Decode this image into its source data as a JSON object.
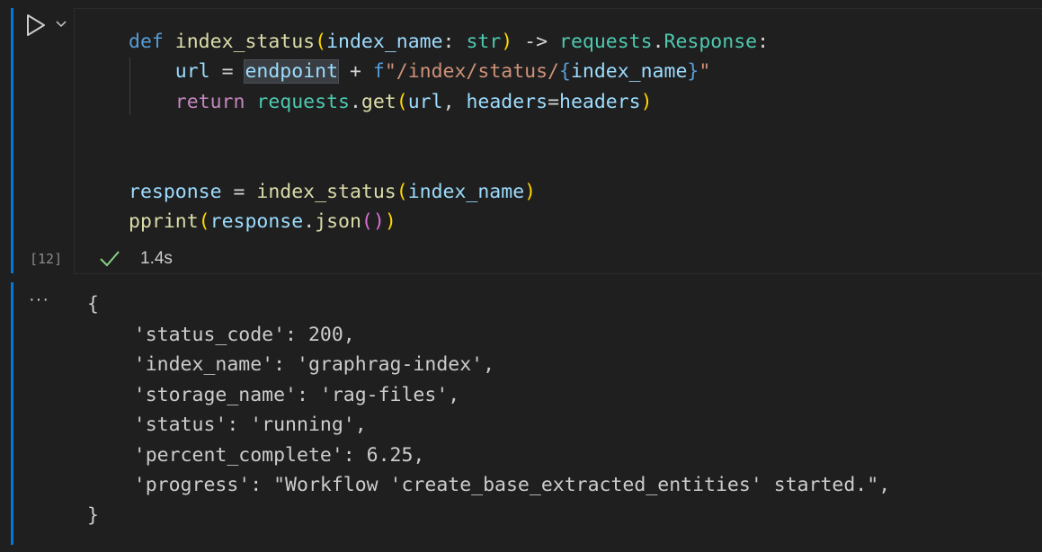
{
  "cell": {
    "execution_count": "[12]",
    "exec_time": "1.4s",
    "status": "success",
    "code": {
      "line1": {
        "kw": "def",
        "fn": "index_status",
        "paren_open": "(",
        "param": "index_name",
        "colon": ": ",
        "type": "str",
        "paren_close": ")",
        "arrow": " -> ",
        "module": "requests",
        "dot": ".",
        "ret_type": "Response",
        "end": ":"
      },
      "line2": {
        "var": "url",
        "eq": " = ",
        "endpoint": "endpoint",
        "plus": " + ",
        "fprefix": "f",
        "str_start": "\"/index/status/",
        "brace_open": "{",
        "interp": "index_name",
        "brace_close": "}",
        "str_end": "\""
      },
      "line3": {
        "kw": "return",
        "module": "requests",
        "dot": ".",
        "fn": "get",
        "paren_open": "(",
        "arg1": "url",
        "comma": ", ",
        "kwarg": "headers",
        "eq": "=",
        "kwval": "headers",
        "paren_close": ")"
      },
      "line6": {
        "var": "response",
        "eq": " = ",
        "fn": "index_status",
        "paren_open": "(",
        "arg": "index_name",
        "paren_close": ")"
      },
      "line7": {
        "fn": "pprint",
        "paren_open": "(",
        "obj": "response",
        "dot": ".",
        "method": "json",
        "inner_open": "(",
        "inner_close": ")",
        "paren_close": ")"
      }
    }
  },
  "output": {
    "more_label": "···",
    "lines": [
      "{",
      "    'status_code': 200,",
      "    'index_name': 'graphrag-index',",
      "    'storage_name': 'rag-files',",
      "    'status': 'running',",
      "    'percent_complete': 6.25,",
      "    'progress': \"Workflow 'create_base_extracted_entities' started.\",",
      "}"
    ]
  },
  "icons": {
    "run": "play-icon",
    "run_menu": "chevron-down-icon",
    "status": "check-icon"
  },
  "colors": {
    "cell_accent": "#0078d4",
    "success": "#89d185",
    "background": "#1f1f1f"
  }
}
